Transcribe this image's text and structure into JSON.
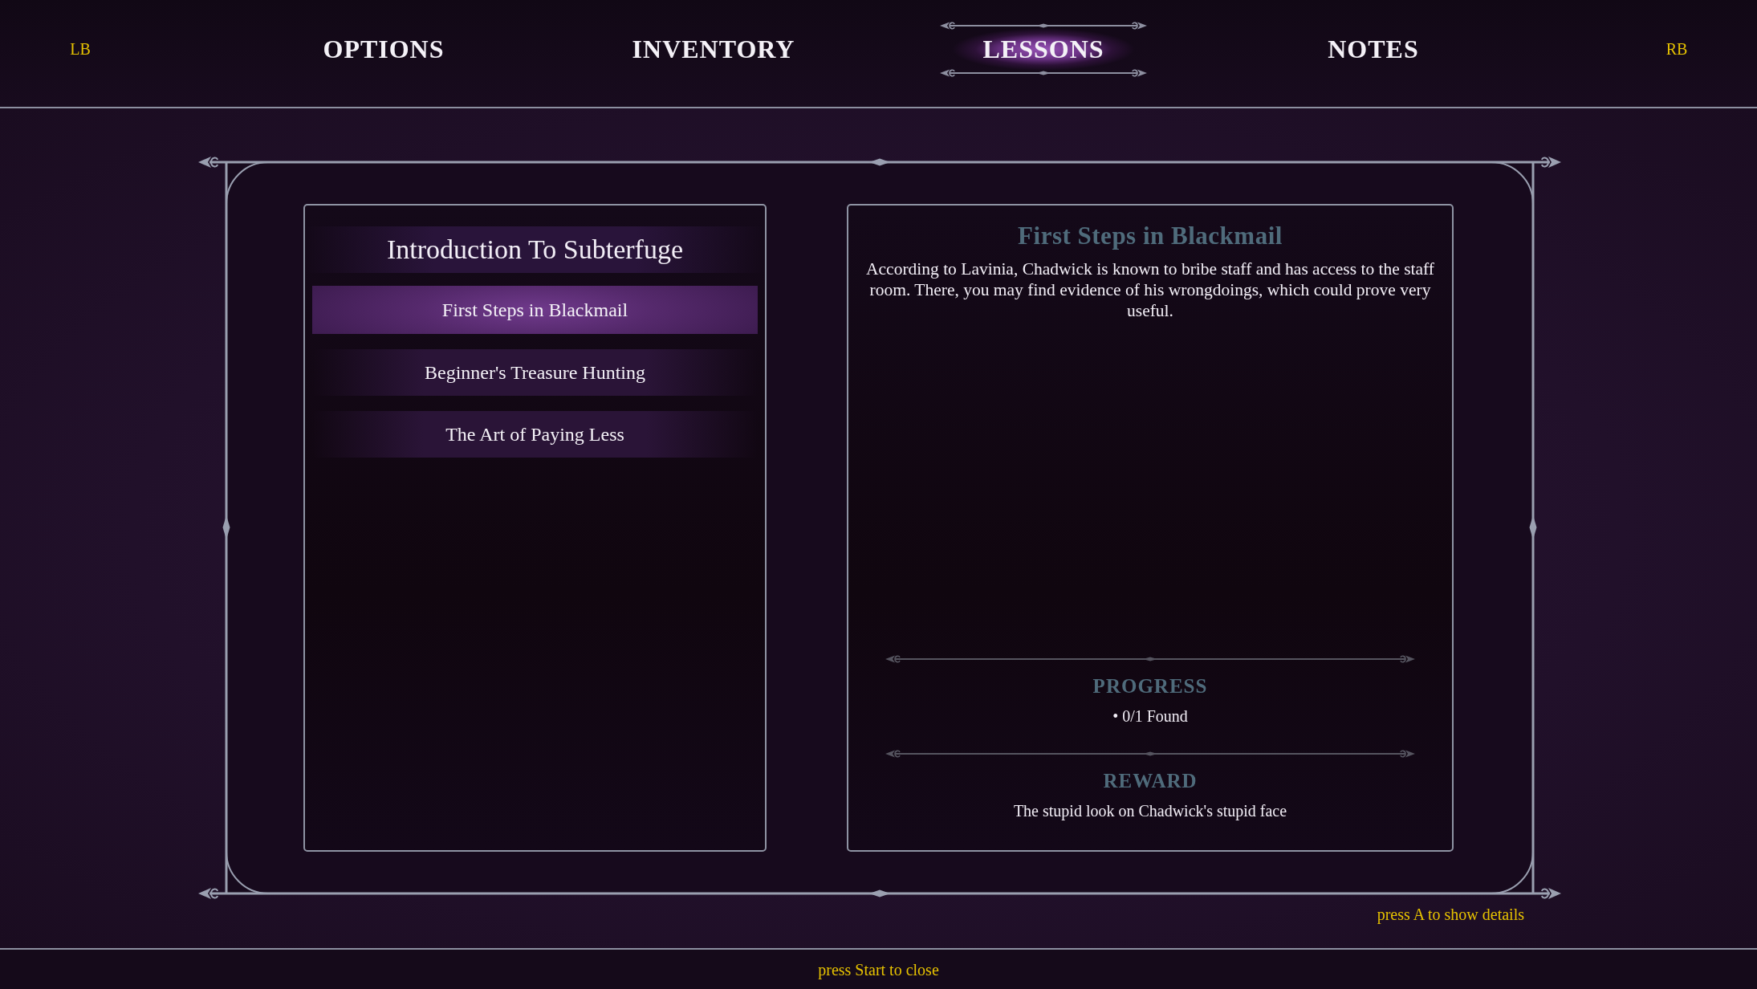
{
  "tab_bar": {
    "left_hint": "LB",
    "tabs": [
      {
        "label": "OPTIONS",
        "selected": false
      },
      {
        "label": "INVENTORY",
        "selected": false
      },
      {
        "label": "LESSONS",
        "selected": true
      },
      {
        "label": "NOTES",
        "selected": false
      }
    ],
    "right_hint": "RB"
  },
  "lesson_list": {
    "title": "Introduction To Subterfuge",
    "items": [
      {
        "label": "First Steps in Blackmail",
        "selected": true
      },
      {
        "label": "Beginner's Treasure Hunting",
        "selected": false
      },
      {
        "label": "The Art of Paying Less",
        "selected": false
      }
    ]
  },
  "lesson_detail": {
    "title": "First Steps in Blackmail",
    "description": "According to Lavinia, Chadwick is known to bribe staff and has access to the staff room. There, you may find evidence of his wrongdoings, which could prove very useful.",
    "sections": [
      {
        "heading": "PROGRESS",
        "text": "• 0/1 Found"
      },
      {
        "heading": "REWARD",
        "text": "The stupid look on Chadwick's stupid face"
      }
    ]
  },
  "hints": {
    "details": "press A to show details",
    "close": "press Start to close"
  }
}
